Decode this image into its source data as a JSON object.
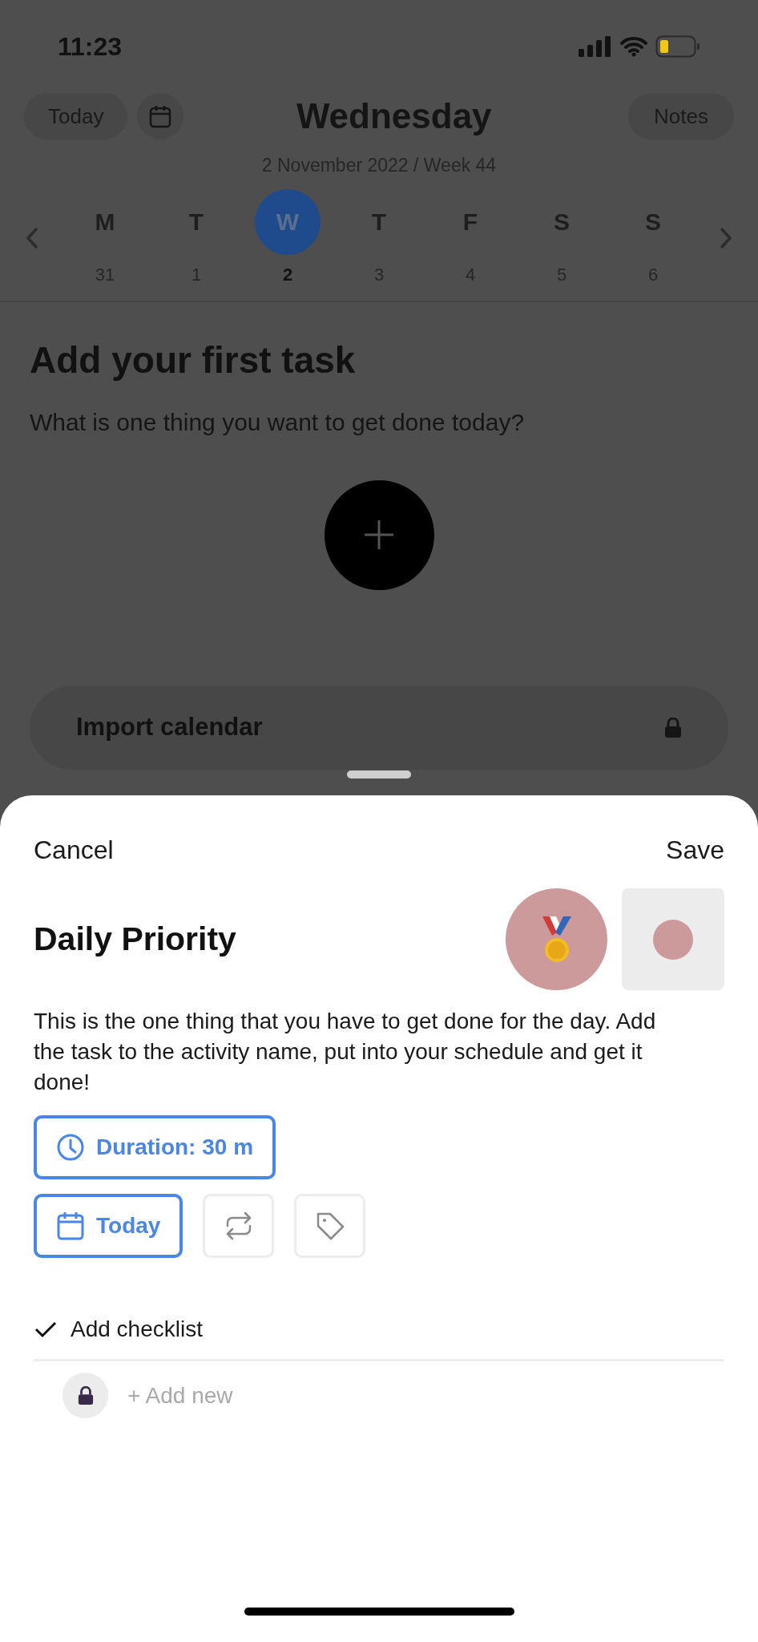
{
  "status_bar": {
    "time": "11:23"
  },
  "header": {
    "today_button": "Today",
    "title": "Wednesday",
    "notes_button": "Notes",
    "subtitle": "2 November 2022 / Week 44"
  },
  "week": [
    {
      "letter": "M",
      "date": "31",
      "selected": false
    },
    {
      "letter": "T",
      "date": "1",
      "selected": false
    },
    {
      "letter": "W",
      "date": "2",
      "selected": true
    },
    {
      "letter": "T",
      "date": "3",
      "selected": false
    },
    {
      "letter": "F",
      "date": "4",
      "selected": false
    },
    {
      "letter": "S",
      "date": "5",
      "selected": false
    },
    {
      "letter": "S",
      "date": "6",
      "selected": false
    }
  ],
  "empty_state": {
    "title": "Add your first task",
    "subtitle": "What is one thing you want to get done today?"
  },
  "import_card": {
    "label": "Import calendar",
    "locked": true
  },
  "sheet": {
    "cancel": "Cancel",
    "save": "Save",
    "title": "Daily Priority",
    "color": "#cd9a9b",
    "description": "This is the one thing that you have to get done for the day. Add the task to the activity name, put into your schedule and get it done!",
    "option_rows": [
      [
        {
          "kind": "duration",
          "label": "Duration: 30 m",
          "active": true
        }
      ],
      [
        {
          "kind": "date",
          "label": "Today",
          "active": true
        },
        {
          "kind": "repeat",
          "active": false
        },
        {
          "kind": "tag",
          "active": false
        }
      ]
    ],
    "checklist": {
      "label": "Add checklist",
      "add_placeholder": "+ Add new",
      "locked": true
    }
  }
}
